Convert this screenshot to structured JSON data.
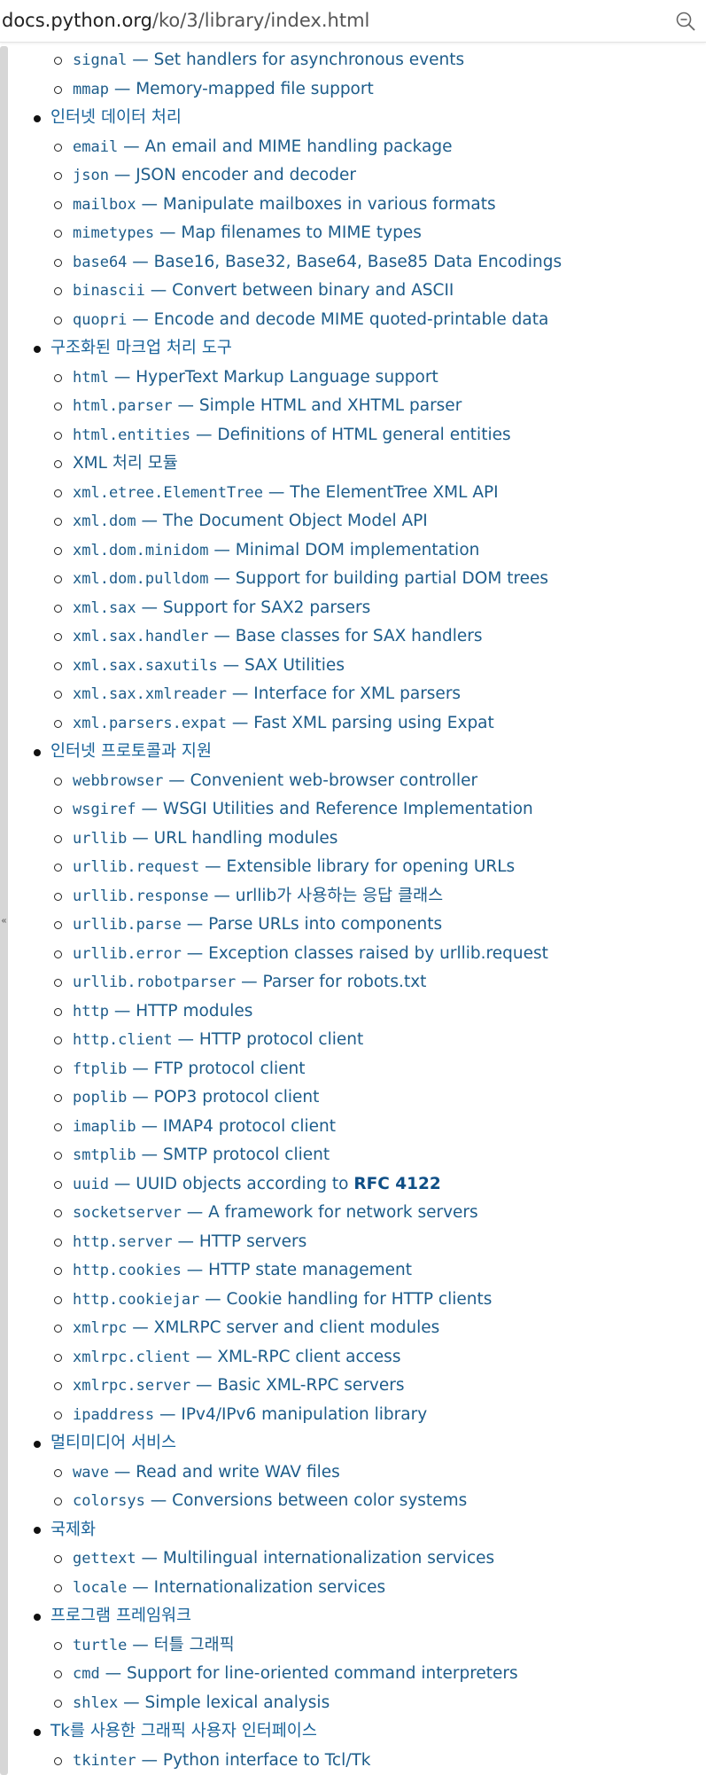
{
  "browser": {
    "url_host": "docs.python.org",
    "url_path": "/ko/3/library/index.html",
    "zoom_icon": "zoom-out-icon",
    "sidebar_toggle": "«"
  },
  "colors": {
    "link": "#1d5c8a",
    "heading_link": "#19639a",
    "rfc": "#0f4f86",
    "sidebar": "#d6d6d6"
  },
  "toc": [
    {
      "category": "",
      "items": [
        {
          "code": "signal",
          "desc": " — Set handlers for asynchronous events"
        },
        {
          "code": "mmap",
          "desc": " — Memory-mapped file support"
        }
      ]
    },
    {
      "category": "인터넷 데이터 처리",
      "items": [
        {
          "code": "email",
          "desc": " — An email and MIME handling package"
        },
        {
          "code": "json",
          "desc": " — JSON encoder and decoder"
        },
        {
          "code": "mailbox",
          "desc": " — Manipulate mailboxes in various formats"
        },
        {
          "code": "mimetypes",
          "desc": " — Map filenames to MIME types"
        },
        {
          "code": "base64",
          "desc": " — Base16, Base32, Base64, Base85 Data Encodings"
        },
        {
          "code": "binascii",
          "desc": " — Convert between binary and ASCII"
        },
        {
          "code": "quopri",
          "desc": " — Encode and decode MIME quoted-printable data"
        }
      ]
    },
    {
      "category": "구조화된 마크업 처리 도구",
      "items": [
        {
          "code": "html",
          "desc": " — HyperText Markup Language support"
        },
        {
          "code": "html.parser",
          "desc": " — Simple HTML and XHTML parser"
        },
        {
          "code": "html.entities",
          "desc": " — Definitions of HTML general entities"
        },
        {
          "code": "",
          "desc": "XML 처리 모듈"
        },
        {
          "code": "xml.etree.ElementTree",
          "desc": " — The ElementTree XML API"
        },
        {
          "code": "xml.dom",
          "desc": " — The Document Object Model API"
        },
        {
          "code": "xml.dom.minidom",
          "desc": " — Minimal DOM implementation"
        },
        {
          "code": "xml.dom.pulldom",
          "desc": " — Support for building partial DOM trees"
        },
        {
          "code": "xml.sax",
          "desc": " — Support for SAX2 parsers"
        },
        {
          "code": "xml.sax.handler",
          "desc": " — Base classes for SAX handlers"
        },
        {
          "code": "xml.sax.saxutils",
          "desc": " — SAX Utilities"
        },
        {
          "code": "xml.sax.xmlreader",
          "desc": " — Interface for XML parsers"
        },
        {
          "code": "xml.parsers.expat",
          "desc": " — Fast XML parsing using Expat"
        }
      ]
    },
    {
      "category": "인터넷 프로토콜과 지원",
      "items": [
        {
          "code": "webbrowser",
          "desc": " — Convenient web-browser controller"
        },
        {
          "code": "wsgiref",
          "desc": " — WSGI Utilities and Reference Implementation"
        },
        {
          "code": "urllib",
          "desc": " — URL handling modules"
        },
        {
          "code": "urllib.request",
          "desc": " — Extensible library for opening URLs"
        },
        {
          "code": "urllib.response",
          "desc": " — urllib가 사용하는 응답 클래스"
        },
        {
          "code": "urllib.parse",
          "desc": " — Parse URLs into components"
        },
        {
          "code": "urllib.error",
          "desc": " — Exception classes raised by urllib.request"
        },
        {
          "code": "urllib.robotparser",
          "desc": " — Parser for robots.txt"
        },
        {
          "code": "http",
          "desc": " — HTTP modules"
        },
        {
          "code": "http.client",
          "desc": " — HTTP protocol client"
        },
        {
          "code": "ftplib",
          "desc": " — FTP protocol client"
        },
        {
          "code": "poplib",
          "desc": " — POP3 protocol client"
        },
        {
          "code": "imaplib",
          "desc": " — IMAP4 protocol client"
        },
        {
          "code": "smtplib",
          "desc": " — SMTP protocol client"
        },
        {
          "code": "uuid",
          "desc": " — UUID objects according to ",
          "strong": "RFC 4122"
        },
        {
          "code": "socketserver",
          "desc": " — A framework for network servers"
        },
        {
          "code": "http.server",
          "desc": " — HTTP servers"
        },
        {
          "code": "http.cookies",
          "desc": " — HTTP state management"
        },
        {
          "code": "http.cookiejar",
          "desc": " — Cookie handling for HTTP clients"
        },
        {
          "code": "xmlrpc",
          "desc": " — XMLRPC server and client modules"
        },
        {
          "code": "xmlrpc.client",
          "desc": " — XML-RPC client access"
        },
        {
          "code": "xmlrpc.server",
          "desc": " — Basic XML-RPC servers"
        },
        {
          "code": "ipaddress",
          "desc": " — IPv4/IPv6 manipulation library"
        }
      ]
    },
    {
      "category": "멀티미디어 서비스",
      "items": [
        {
          "code": "wave",
          "desc": " — Read and write WAV files"
        },
        {
          "code": "colorsys",
          "desc": " — Conversions between color systems"
        }
      ]
    },
    {
      "category": "국제화",
      "items": [
        {
          "code": "gettext",
          "desc": " — Multilingual internationalization services"
        },
        {
          "code": "locale",
          "desc": " — Internationalization services"
        }
      ]
    },
    {
      "category": "프로그램 프레임워크",
      "items": [
        {
          "code": "turtle",
          "desc": " — 터틀 그래픽"
        },
        {
          "code": "cmd",
          "desc": " — Support for line-oriented command interpreters"
        },
        {
          "code": "shlex",
          "desc": " — Simple lexical analysis"
        }
      ]
    },
    {
      "category": "Tk를 사용한 그래픽 사용자 인터페이스",
      "items": [
        {
          "code": "tkinter",
          "desc": " — Python interface to Tcl/Tk"
        }
      ]
    }
  ]
}
